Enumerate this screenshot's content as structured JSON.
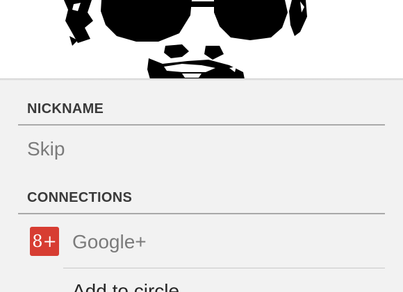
{
  "photo": {
    "description_icon": "contact-photo"
  },
  "nickname": {
    "header": "NICKNAME",
    "value": "Skip"
  },
  "connections": {
    "header": "CONNECTIONS",
    "items": [
      {
        "icon": "google-plus-icon",
        "icon_glyph": "8+",
        "icon_color": "#d73d32",
        "label": "Google+"
      }
    ],
    "action_label": "Add to circle"
  },
  "colors": {
    "background": "#f2f2f2",
    "header_text": "#3a3a3a",
    "value_text": "#7b7b7b",
    "google_plus": "#d73d32"
  }
}
